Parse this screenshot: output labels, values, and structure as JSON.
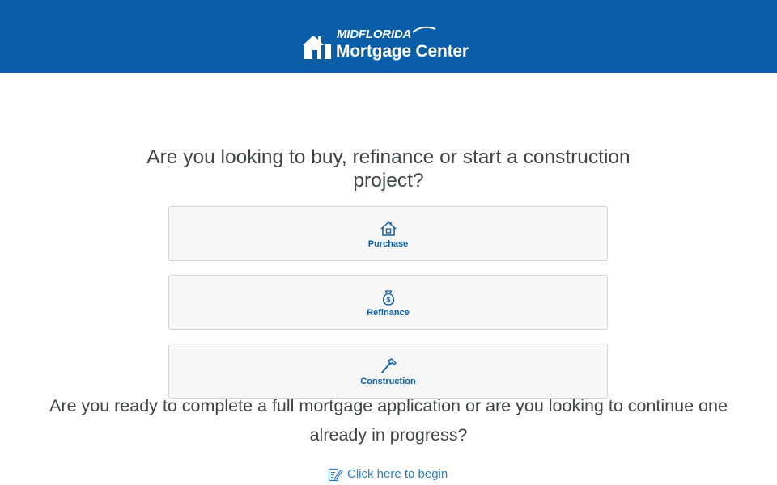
{
  "header": {
    "logo_brand": "MIDFLORIDA",
    "logo_product": "Mortgage Center",
    "color": "#0a5ea8"
  },
  "main": {
    "question_1": "Are you looking to buy, refinance or start a construction project?",
    "options": [
      {
        "label": "Purchase",
        "icon": "house-icon"
      },
      {
        "label": "Refinance",
        "icon": "money-bag-icon"
      },
      {
        "label": "Construction",
        "icon": "hammer-icon"
      }
    ],
    "question_2": "Are you ready to complete a full mortgage application or are you looking to continue one already in progress?",
    "begin_link": {
      "label": "Click here to begin",
      "icon": "edit-form-icon"
    }
  },
  "colors": {
    "accent": "#0a5ea8",
    "link": "#2f7fc4",
    "text": "#3f4448",
    "card_bg": "#f8f8f8",
    "card_border": "#d4d4d4"
  }
}
